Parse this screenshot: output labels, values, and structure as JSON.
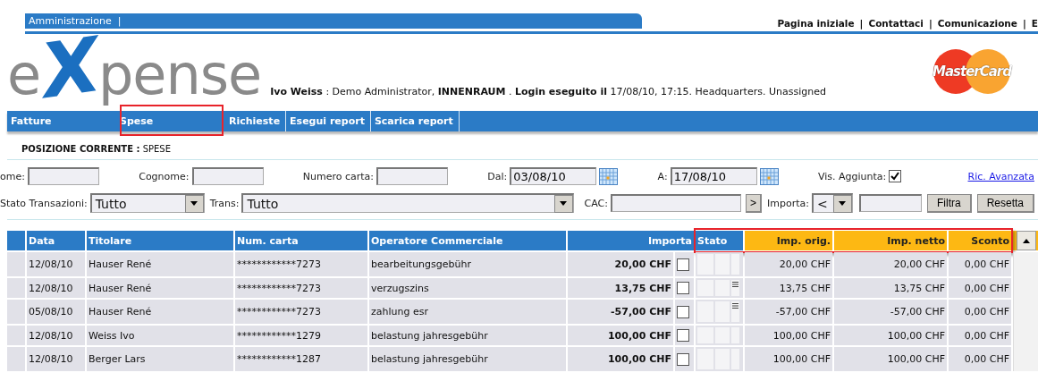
{
  "top_tab": {
    "label": "Amministrazione",
    "separator": "|"
  },
  "top_links": [
    "Pagina iniziale",
    "Contattaci",
    "Comunicazione",
    "E"
  ],
  "top_link_separator": "|",
  "logo": {
    "lead": "e",
    "mark": "X",
    "rest": "pense"
  },
  "user_info": "**Ivo Weiss** : Demo Administrator, **INNENRAUM** . **Login eseguito il** 17/08/10, 17:15. Headquarters. Unassigned",
  "card_logo": {
    "text": "MasterCard"
  },
  "nav": [
    {
      "label": "Fatture",
      "annotated": false
    },
    {
      "label": "Spese",
      "annotated": true
    },
    {
      "label": "Richieste",
      "annotated": false
    },
    {
      "label": "Esegui report",
      "annotated": false
    },
    {
      "label": "Scarica report",
      "annotated": false
    }
  ],
  "breadcrumb": {
    "label": "POSIZIONE CORRENTE :",
    "value": "SPESE"
  },
  "filters_row_1": [
    {
      "kind": "text",
      "label": "ome:"
    },
    {
      "kind": "text",
      "label": "Cognome:"
    },
    {
      "kind": "text",
      "label": "Numero carta:"
    },
    {
      "kind": "date",
      "label": "Dal:",
      "value": "03/08/10"
    },
    {
      "kind": "date",
      "label": "A:",
      "value": "17/08/10"
    },
    {
      "kind": "checkbox",
      "label": "Vis. Aggiunta:",
      "checked": true
    },
    {
      "kind": "link",
      "label": "Ric. Avanzata"
    }
  ],
  "filters_row_2": [
    {
      "kind": "select",
      "label": "Stato Transazioni:",
      "value": "Tutto"
    },
    {
      "kind": "wideselect",
      "label": "Trans:",
      "value": "Tutto"
    },
    {
      "kind": "lookup",
      "label": "CAC:",
      "button": ">"
    },
    {
      "kind": "compare",
      "label": "Importa:",
      "value": "<"
    },
    {
      "kind": "button",
      "label": "Filtra"
    },
    {
      "kind": "button",
      "label": "Resetta"
    }
  ],
  "table": {
    "columns": [
      {
        "label": "Data",
        "color": "#2b7bc6",
        "annotated": false
      },
      {
        "label": "Titolare",
        "color": "#2b7bc6",
        "annotated": false
      },
      {
        "label": "Num. carta",
        "color": "#2b7bc6",
        "annotated": false
      },
      {
        "label": "Operatore Commerciale",
        "color": "#2b7bc6",
        "annotated": false
      },
      {
        "label": "Importa",
        "color": "#2b7bc6",
        "annotated": false
      },
      {
        "label": "Stato",
        "color": "#2b7bc6",
        "annotated": true
      },
      {
        "label": "Imp. orig.",
        "color": "#fdb813",
        "annotated": true
      },
      {
        "label": "Imp. netto",
        "color": "#fdb813",
        "annotated": true
      },
      {
        "label": "Sconto",
        "color": "#fdb813",
        "annotated": true
      }
    ],
    "rows": [
      {
        "data": "12/08/10",
        "titolare": "Hauser René",
        "carta": "************7273",
        "operatore": "bearbeitungsgebühr",
        "importa": "20,00 CHF",
        "checked": false,
        "note": false,
        "orig": "20,00 CHF",
        "netto": "20,00 CHF",
        "sconto": "0,00 CHF"
      },
      {
        "data": "12/08/10",
        "titolare": "Hauser René",
        "carta": "************7273",
        "operatore": "verzugszins",
        "importa": "13,75 CHF",
        "checked": false,
        "note": true,
        "orig": "13,75 CHF",
        "netto": "13,75 CHF",
        "sconto": "0,00 CHF"
      },
      {
        "data": "05/08/10",
        "titolare": "Hauser René",
        "carta": "************7273",
        "operatore": "zahlung esr",
        "importa": "-57,00 CHF",
        "checked": false,
        "note": true,
        "orig": "-57,00 CHF",
        "netto": "-57,00 CHF",
        "sconto": "0,00 CHF"
      },
      {
        "data": "12/08/10",
        "titolare": "Weiss Ivo",
        "carta": "************1279",
        "operatore": "belastung jahresgebühr",
        "importa": "100,00 CHF",
        "checked": false,
        "note": false,
        "orig": "100,00 CHF",
        "netto": "100,00 CHF",
        "sconto": "0,00 CHF"
      },
      {
        "data": "12/08/10",
        "titolare": "Berger Lars",
        "carta": "************1287",
        "operatore": "belastung jahresgebühr",
        "importa": "100,00 CHF",
        "checked": false,
        "note": false,
        "orig": "100,00 CHF",
        "netto": "100,00 CHF",
        "sconto": "0,00 CHF"
      }
    ]
  }
}
